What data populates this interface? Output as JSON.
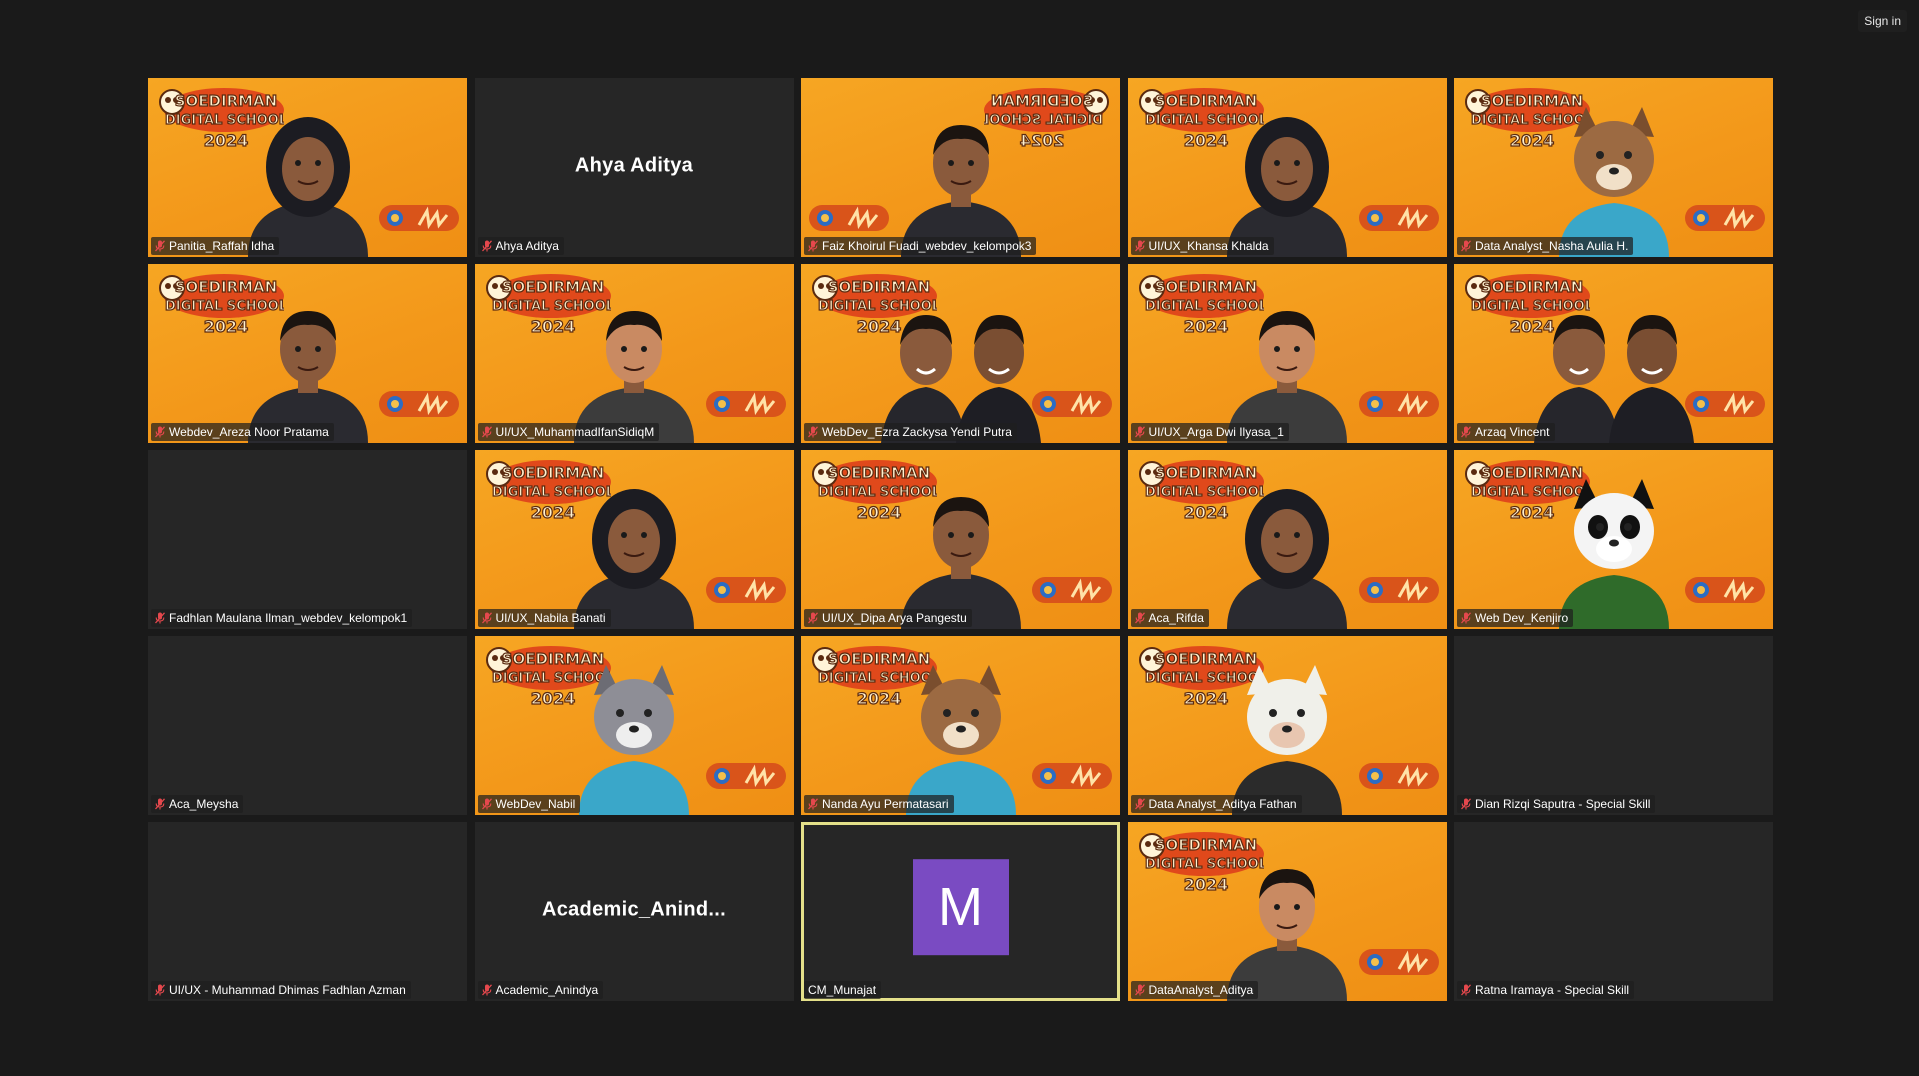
{
  "window": {
    "sign_in_label": "Sign in"
  },
  "colors": {
    "background": "#1a1a1a",
    "tile_empty": "#262626",
    "video_orange": "#f6a623",
    "active_speaker_border": "#e4e08a",
    "avatar_purple": "#7a4bc2",
    "mic_muted_red": "#e5484d"
  },
  "participants": [
    {
      "name": "Panitia_Raffah Idha",
      "type": "video",
      "figure": "person-hijab"
    },
    {
      "name": "Ahya Aditya",
      "type": "name",
      "display_name": "Ahya Aditya"
    },
    {
      "name": "Faiz Khoirul Fuadi_webdev_kelompok3",
      "type": "video",
      "figure": "person"
    },
    {
      "name": "UI/UX_Khansa Khalda",
      "type": "video",
      "figure": "person-hijab"
    },
    {
      "name": "Data Analyst_Nasha Aulia H.",
      "type": "video",
      "figure": "dog-avatar"
    },
    {
      "name": "Webdev_Areza Noor Pratama",
      "type": "video",
      "figure": "person"
    },
    {
      "name": "UI/UX_MuhammadIfanSidiqM",
      "type": "video",
      "figure": "avatar-3d"
    },
    {
      "name": "WebDev_Ezra Zackysa Yendi Putra",
      "type": "video",
      "figure": "two-people"
    },
    {
      "name": "UI/UX_Arga Dwi Ilyasa_1",
      "type": "video",
      "figure": "avatar-3d"
    },
    {
      "name": "Arzaq Vincent",
      "type": "video",
      "figure": "two-people"
    },
    {
      "name": "Fadhlan Maulana Ilman_webdev_kelompok1",
      "type": "empty"
    },
    {
      "name": "UI/UX_Nabila Banati",
      "type": "video",
      "figure": "person-hijab"
    },
    {
      "name": "UI/UX_Dipa Arya Pangestu",
      "type": "video",
      "figure": "person"
    },
    {
      "name": "Aca_Rifda",
      "type": "video",
      "figure": "person-hijab"
    },
    {
      "name": "Web Dev_Kenjiro",
      "type": "video",
      "figure": "panda-avatar"
    },
    {
      "name": "Aca_Meysha",
      "type": "empty"
    },
    {
      "name": "WebDev_Nabil",
      "type": "video",
      "figure": "cat-avatar"
    },
    {
      "name": "Nanda Ayu Permatasari",
      "type": "video",
      "figure": "dog-avatar"
    },
    {
      "name": "Data Analyst_Aditya Fathan",
      "type": "video",
      "figure": "cow-avatar"
    },
    {
      "name": "Dian Rizqi Saputra - Special Skill",
      "type": "empty"
    },
    {
      "name": "UI/UX - Muhammad Dhimas Fadhlan Azman",
      "type": "empty"
    },
    {
      "name": "Academic_Anindya",
      "type": "name",
      "display_name": "Academic_Anind..."
    },
    {
      "name": "CM_Munajat",
      "type": "avatar",
      "initial": "M",
      "active": true
    },
    {
      "name": "DataAnalyst_Aditya",
      "type": "video",
      "figure": "avatar-3d"
    },
    {
      "name": "Ratna Iramaya - Special Skill",
      "type": "empty"
    }
  ],
  "banner_text": {
    "line1": "SOEDIRMAN",
    "line2": "DIGITAL SCHOOL",
    "line3": "2024"
  }
}
